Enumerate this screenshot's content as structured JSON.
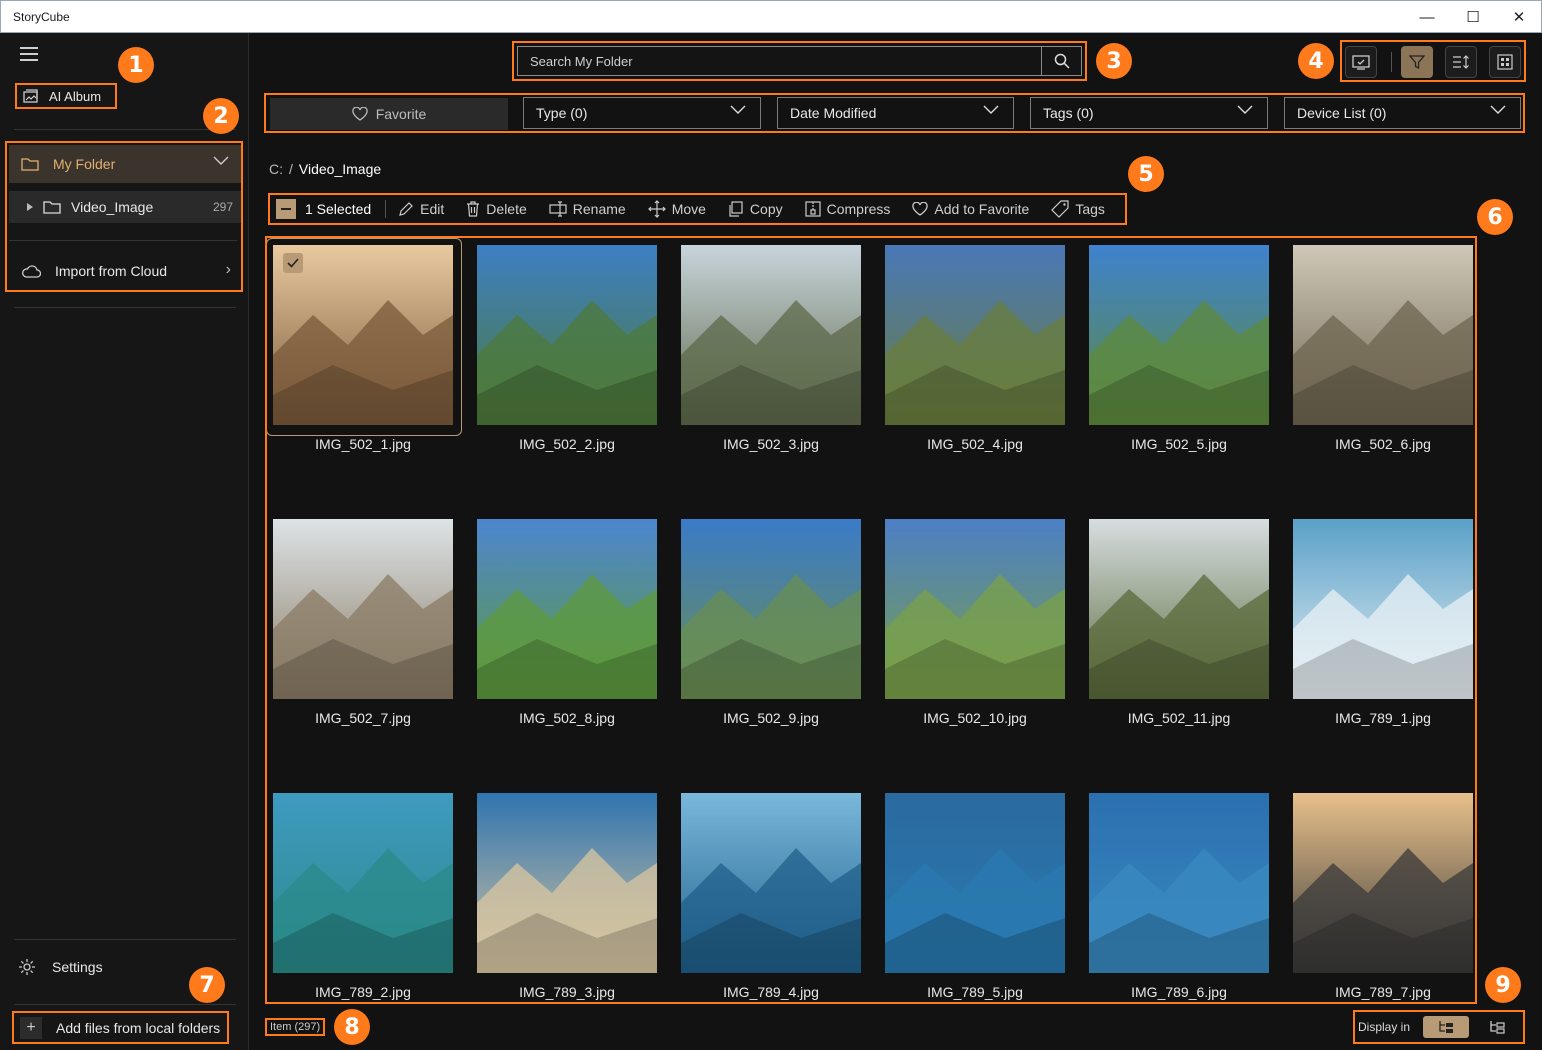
{
  "window": {
    "title": "StoryCube",
    "minimize": "—",
    "maximize": "☐",
    "close": "✕"
  },
  "sidebar": {
    "ai_album": "AI Album",
    "my_folder": "My Folder",
    "folder_item": {
      "label": "Video_Image",
      "count": "297"
    },
    "import_cloud": "Import from Cloud",
    "settings": "Settings",
    "add_files": "Add files from local folders"
  },
  "search": {
    "placeholder": "Search My Folder"
  },
  "filters": {
    "favorite": "Favorite",
    "type": "Type (0)",
    "date": "Date Modified",
    "tags": "Tags (0)",
    "device": "Device List (0)"
  },
  "breadcrumb": {
    "drive": "C:",
    "separator": "/",
    "current": "Video_Image"
  },
  "actions": {
    "selected": "1 Selected",
    "edit": "Edit",
    "delete": "Delete",
    "rename": "Rename",
    "move": "Move",
    "copy": "Copy",
    "compress": "Compress",
    "favorite": "Add to Favorite",
    "tags": "Tags"
  },
  "files": [
    {
      "name": "IMG_502_1.jpg",
      "selected": true,
      "sky": "#e8c9a0",
      "ground": "#7a5a3a"
    },
    {
      "name": "IMG_502_2.jpg",
      "selected": false,
      "sky": "#3d7fc4",
      "ground": "#4e7a3a"
    },
    {
      "name": "IMG_502_3.jpg",
      "selected": false,
      "sky": "#c8d4dc",
      "ground": "#5e6a4a"
    },
    {
      "name": "IMG_502_4.jpg",
      "selected": false,
      "sky": "#4a78b8",
      "ground": "#6a7d3e"
    },
    {
      "name": "IMG_502_5.jpg",
      "selected": false,
      "sky": "#3f82cf",
      "ground": "#5d8a3c"
    },
    {
      "name": "IMG_502_6.jpg",
      "selected": false,
      "sky": "#cfc8b8",
      "ground": "#6f6550"
    },
    {
      "name": "IMG_502_7.jpg",
      "selected": false,
      "sky": "#dde3e6",
      "ground": "#8a7b64"
    },
    {
      "name": "IMG_502_8.jpg",
      "selected": false,
      "sky": "#4d86d0",
      "ground": "#5e9a3c"
    },
    {
      "name": "IMG_502_9.jpg",
      "selected": false,
      "sky": "#3b7bc8",
      "ground": "#6a8e52"
    },
    {
      "name": "IMG_502_10.jpg",
      "selected": false,
      "sky": "#4c7fc6",
      "ground": "#7aa048"
    },
    {
      "name": "IMG_502_11.jpg",
      "selected": false,
      "sky": "#d7dde0",
      "ground": "#5a6a3a"
    },
    {
      "name": "IMG_789_1.jpg",
      "selected": false,
      "sky": "#5aa0c8",
      "ground": "#e8f0f4"
    },
    {
      "name": "IMG_789_2.jpg",
      "selected": false,
      "sky": "#3f9ac0",
      "ground": "#2a8a8a"
    },
    {
      "name": "IMG_789_3.jpg",
      "selected": false,
      "sky": "#2f74b0",
      "ground": "#d8c6a0"
    },
    {
      "name": "IMG_789_4.jpg",
      "selected": false,
      "sky": "#7ab8dc",
      "ground": "#1f5f8a"
    },
    {
      "name": "IMG_789_5.jpg",
      "selected": false,
      "sky": "#2a6aa0",
      "ground": "#2a7ab0"
    },
    {
      "name": "IMG_789_6.jpg",
      "selected": false,
      "sky": "#2a70b0",
      "ground": "#3a8ac0"
    },
    {
      "name": "IMG_789_7.jpg",
      "selected": false,
      "sky": "#e8c08a",
      "ground": "#3a3a3a"
    }
  ],
  "status": {
    "item_count": "Item (297)",
    "display_in": "Display in"
  },
  "badges": [
    "1",
    "2",
    "3",
    "4",
    "5",
    "6",
    "7",
    "8",
    "9"
  ],
  "colors": {
    "accent": "#ff7a1a",
    "selected": "#b89a76",
    "folder_active": "#e2b070"
  }
}
